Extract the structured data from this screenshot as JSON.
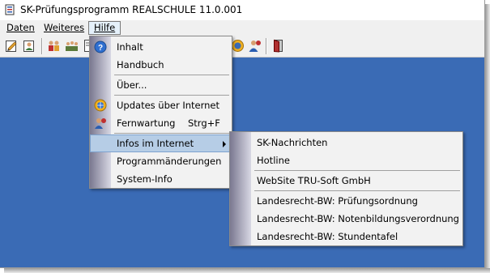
{
  "window": {
    "title": "SK-Prüfungsprogramm REALSCHULE 11.0.001"
  },
  "menubar": {
    "items": [
      "Daten",
      "Weiteres",
      "Hilfe"
    ]
  },
  "toolbar": {
    "icons": [
      "edit-icon",
      "user-edit-icon",
      "group-icon",
      "class-icon",
      "document-icon",
      "info-icon",
      "support-icon",
      "exit-door-icon"
    ]
  },
  "hilfe_menu": {
    "items": [
      {
        "label": "Inhalt",
        "icon": "help-icon"
      },
      {
        "label": "Handbuch"
      },
      {
        "label": "Über..."
      },
      {
        "label": "Updates über Internet",
        "icon": "update-globe-icon"
      },
      {
        "label": "Fernwartung",
        "shortcut": "Strg+F",
        "icon": "remote-maintenance-icon"
      },
      {
        "label": "Infos im Internet",
        "submenu": true
      },
      {
        "label": "Programmänderungen"
      },
      {
        "label": "System-Info"
      }
    ]
  },
  "infos_submenu": {
    "items": [
      {
        "label": "SK-Nachrichten"
      },
      {
        "label": "Hotline"
      },
      {
        "label": "WebSite TRU-Soft GmbH"
      },
      {
        "label": "Landesrecht-BW: Prüfungsordnung"
      },
      {
        "label": "Landesrecht-BW: Notenbildungsverordnung"
      },
      {
        "label": "Landesrecht-BW: Stundentafel"
      }
    ]
  },
  "colors": {
    "client_background": "#3a6bb5",
    "highlight": "#b6cde6",
    "menu_background": "#f2f2f2"
  }
}
